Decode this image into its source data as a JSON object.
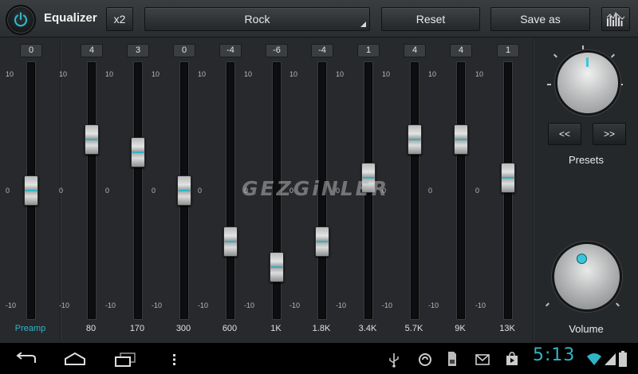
{
  "app": {
    "title": "Equalizer",
    "multiplier_label": "x2",
    "preset_name": "Rock",
    "reset_label": "Reset",
    "save_as_label": "Save as"
  },
  "scale": {
    "top": "10",
    "mid": "0",
    "bottom": "-10"
  },
  "preamp": {
    "gain": "0",
    "label": "Preamp",
    "level": 0
  },
  "bands": [
    {
      "label": "80",
      "gain": "4",
      "level": 4
    },
    {
      "label": "170",
      "gain": "3",
      "level": 3
    },
    {
      "label": "300",
      "gain": "0",
      "level": 0
    },
    {
      "label": "600",
      "gain": "-4",
      "level": -4
    },
    {
      "label": "1K",
      "gain": "-6",
      "level": -6
    },
    {
      "label": "1.8K",
      "gain": "-4",
      "level": -4
    },
    {
      "label": "3.4K",
      "gain": "1",
      "level": 1
    },
    {
      "label": "5.7K",
      "gain": "4",
      "level": 4
    },
    {
      "label": "9K",
      "gain": "4",
      "level": 4
    },
    {
      "label": "13K",
      "gain": "1",
      "level": 1
    }
  ],
  "right_panel": {
    "prev_label": "<<",
    "next_label": ">>",
    "presets_label": "Presets",
    "volume_label": "Volume"
  },
  "watermark": "GEZGiNLER",
  "status_bar": {
    "time": "5:13"
  },
  "colors": {
    "accent": "#2fb4c6",
    "background": "#25282b"
  },
  "icons": {
    "power": "power-icon",
    "spectrum": "spectrum-icon",
    "dropdown": "dropdown-arrow-icon",
    "back": "back-icon",
    "home": "home-icon",
    "recents": "recent-apps-icon",
    "menu": "overflow-menu-icon",
    "usb": "usb-icon",
    "sync": "sync-icon",
    "sd": "sd-card-icon",
    "gmail": "gmail-icon",
    "play_store": "play-store-icon",
    "wifi": "wifi-icon",
    "signal": "signal-icon",
    "battery": "battery-icon"
  }
}
